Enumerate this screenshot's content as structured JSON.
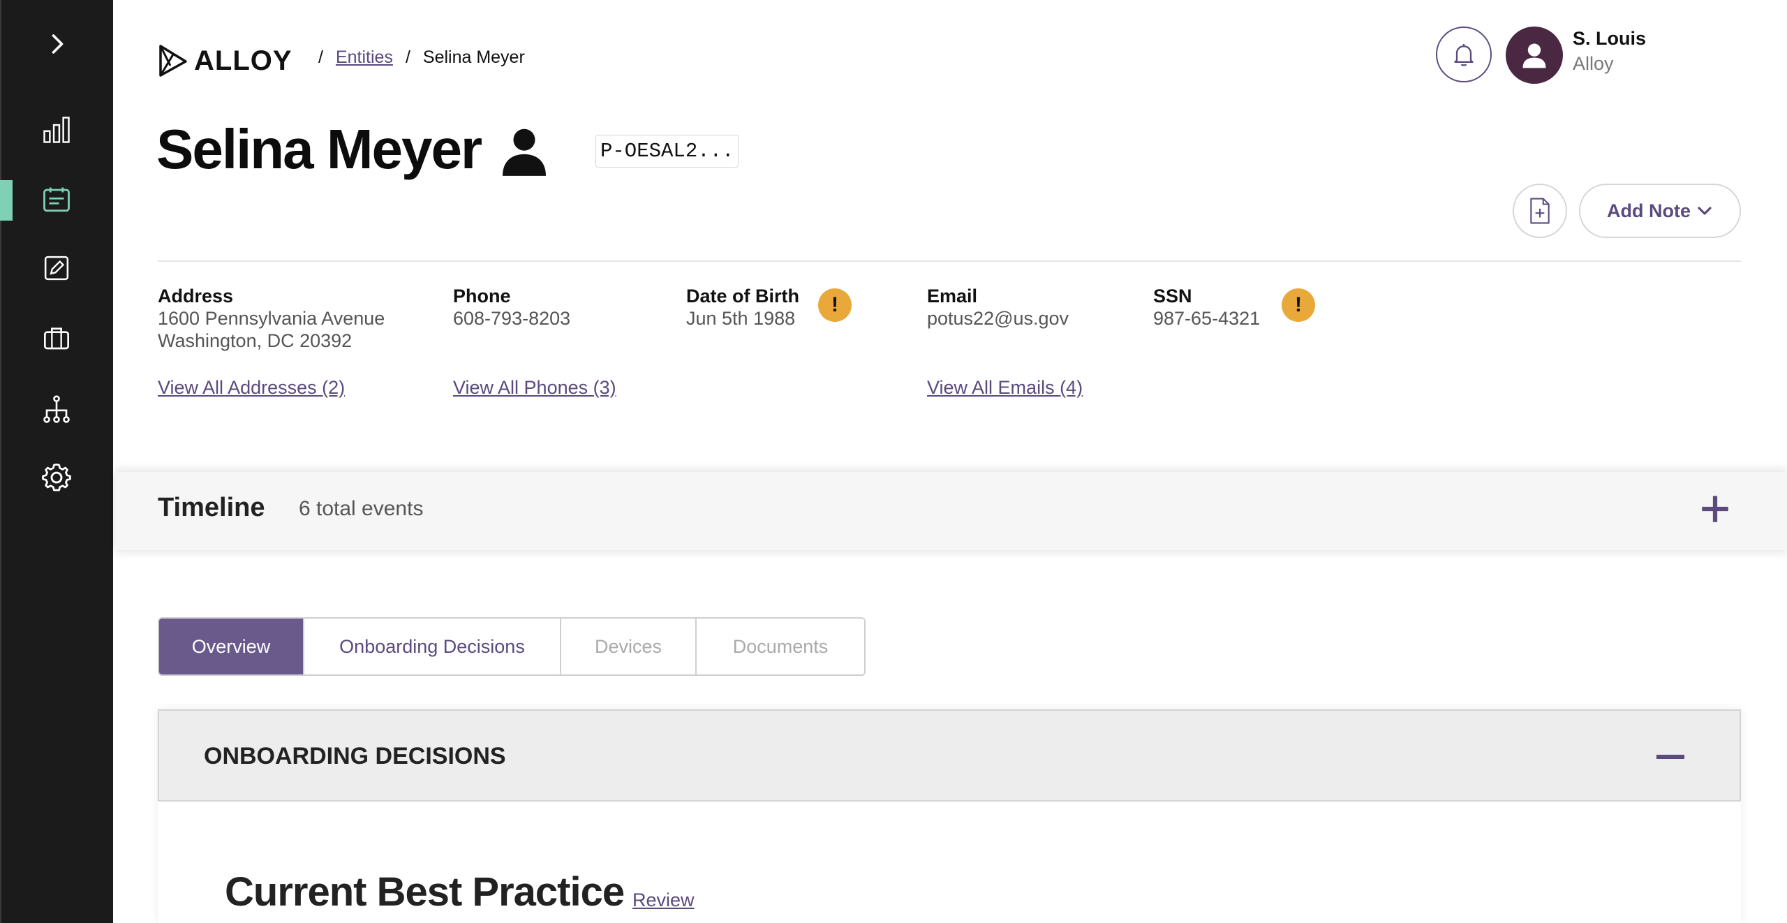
{
  "header": {
    "logo_text": "ALLOY",
    "breadcrumb": {
      "separator": "/",
      "parent": "Entities",
      "current": "Selina Meyer"
    },
    "user": {
      "name": "S. Louis",
      "org": "Alloy"
    }
  },
  "entity": {
    "name": "Selina Meyer",
    "id": "P-OESAL2...",
    "add_note_label": "Add Note"
  },
  "info": {
    "address": {
      "label": "Address",
      "line1": "1600 Pennsylvania Avenue",
      "line2": "Washington, DC 20392",
      "link": "View All Addresses (2)"
    },
    "phone": {
      "label": "Phone",
      "value": "608-793-8203",
      "link": "View All Phones (3)"
    },
    "dob": {
      "label": "Date of Birth",
      "value": "Jun 5th 1988",
      "warning": "!"
    },
    "email": {
      "label": "Email",
      "value": "potus22@us.gov",
      "link": "View All Emails (4)"
    },
    "ssn": {
      "label": "SSN",
      "value": "987-65-4321",
      "warning": "!"
    }
  },
  "timeline": {
    "title": "Timeline",
    "count": "6 total events"
  },
  "tabs": [
    "Overview",
    "Onboarding Decisions",
    "Devices",
    "Documents"
  ],
  "section": {
    "title": "ONBOARDING DECISIONS",
    "item_title": "Current Best Practice",
    "item_link": "Review"
  },
  "colors": {
    "accent": "#5a4a7e",
    "sidebar": "#1b1b1b",
    "active_indicator": "#7ed1b4",
    "warning": "#e8a93a"
  },
  "sidebar_icons": [
    "chevron-right-icon",
    "bar-chart-icon",
    "entities-icon",
    "edit-icon",
    "briefcase-icon",
    "hierarchy-icon",
    "gear-icon"
  ]
}
